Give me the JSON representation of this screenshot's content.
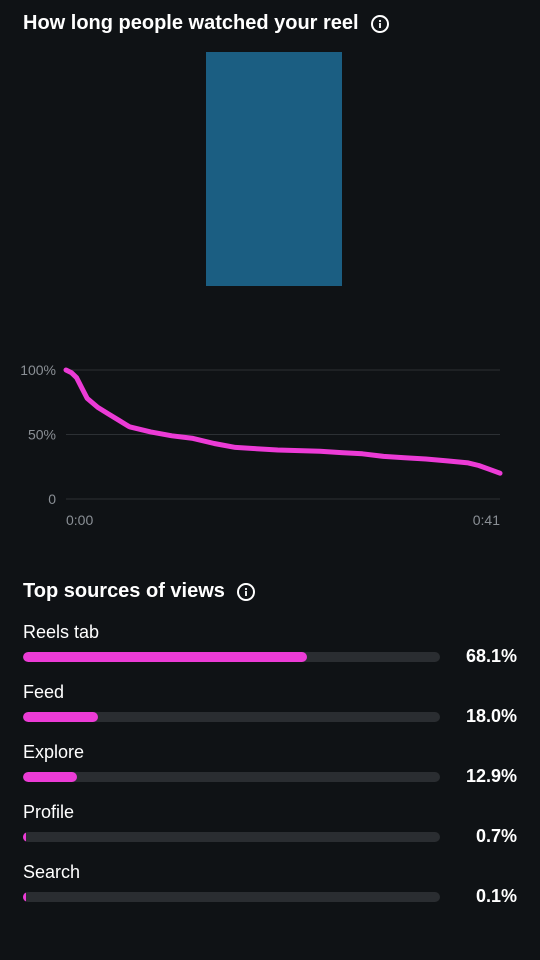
{
  "retention": {
    "title": "How long people watched your reel",
    "info_icon": "info-icon",
    "chart_data": {
      "type": "line",
      "title": "",
      "xlabel": "",
      "ylabel": "",
      "x_tick_labels": [
        "0:00",
        "0:41"
      ],
      "y_tick_labels": [
        "100%",
        "50%",
        "0"
      ],
      "xlim": [
        0,
        41
      ],
      "ylim": [
        0,
        100
      ],
      "grid": true,
      "series": [
        {
          "x": [
            0,
            0.5,
            1,
            1.5,
            2,
            3,
            4,
            5,
            6,
            8,
            10,
            12,
            14,
            16,
            18,
            20,
            22,
            24,
            26,
            28,
            30,
            32,
            34,
            36,
            38,
            39,
            40,
            41
          ],
          "y": [
            100,
            98,
            94,
            86,
            78,
            71,
            66,
            61,
            56,
            52,
            49,
            47,
            43,
            40,
            39,
            38,
            37.5,
            37,
            36,
            35,
            33,
            32,
            31,
            29.5,
            28,
            26,
            23,
            20
          ],
          "color": "#ec3bd6"
        }
      ]
    }
  },
  "sources": {
    "title": "Top sources of views",
    "info_icon": "info-icon",
    "bar_color": "#ec3bd6",
    "track_color": "#2a2d31",
    "items": [
      {
        "label": "Reels tab",
        "value": "68.1%",
        "percent": 68.1
      },
      {
        "label": "Feed",
        "value": "18.0%",
        "percent": 18.0
      },
      {
        "label": "Explore",
        "value": "12.9%",
        "percent": 12.9
      },
      {
        "label": "Profile",
        "value": "0.7%",
        "percent": 0.7
      },
      {
        "label": "Search",
        "value": "0.1%",
        "percent": 0.1
      }
    ]
  }
}
